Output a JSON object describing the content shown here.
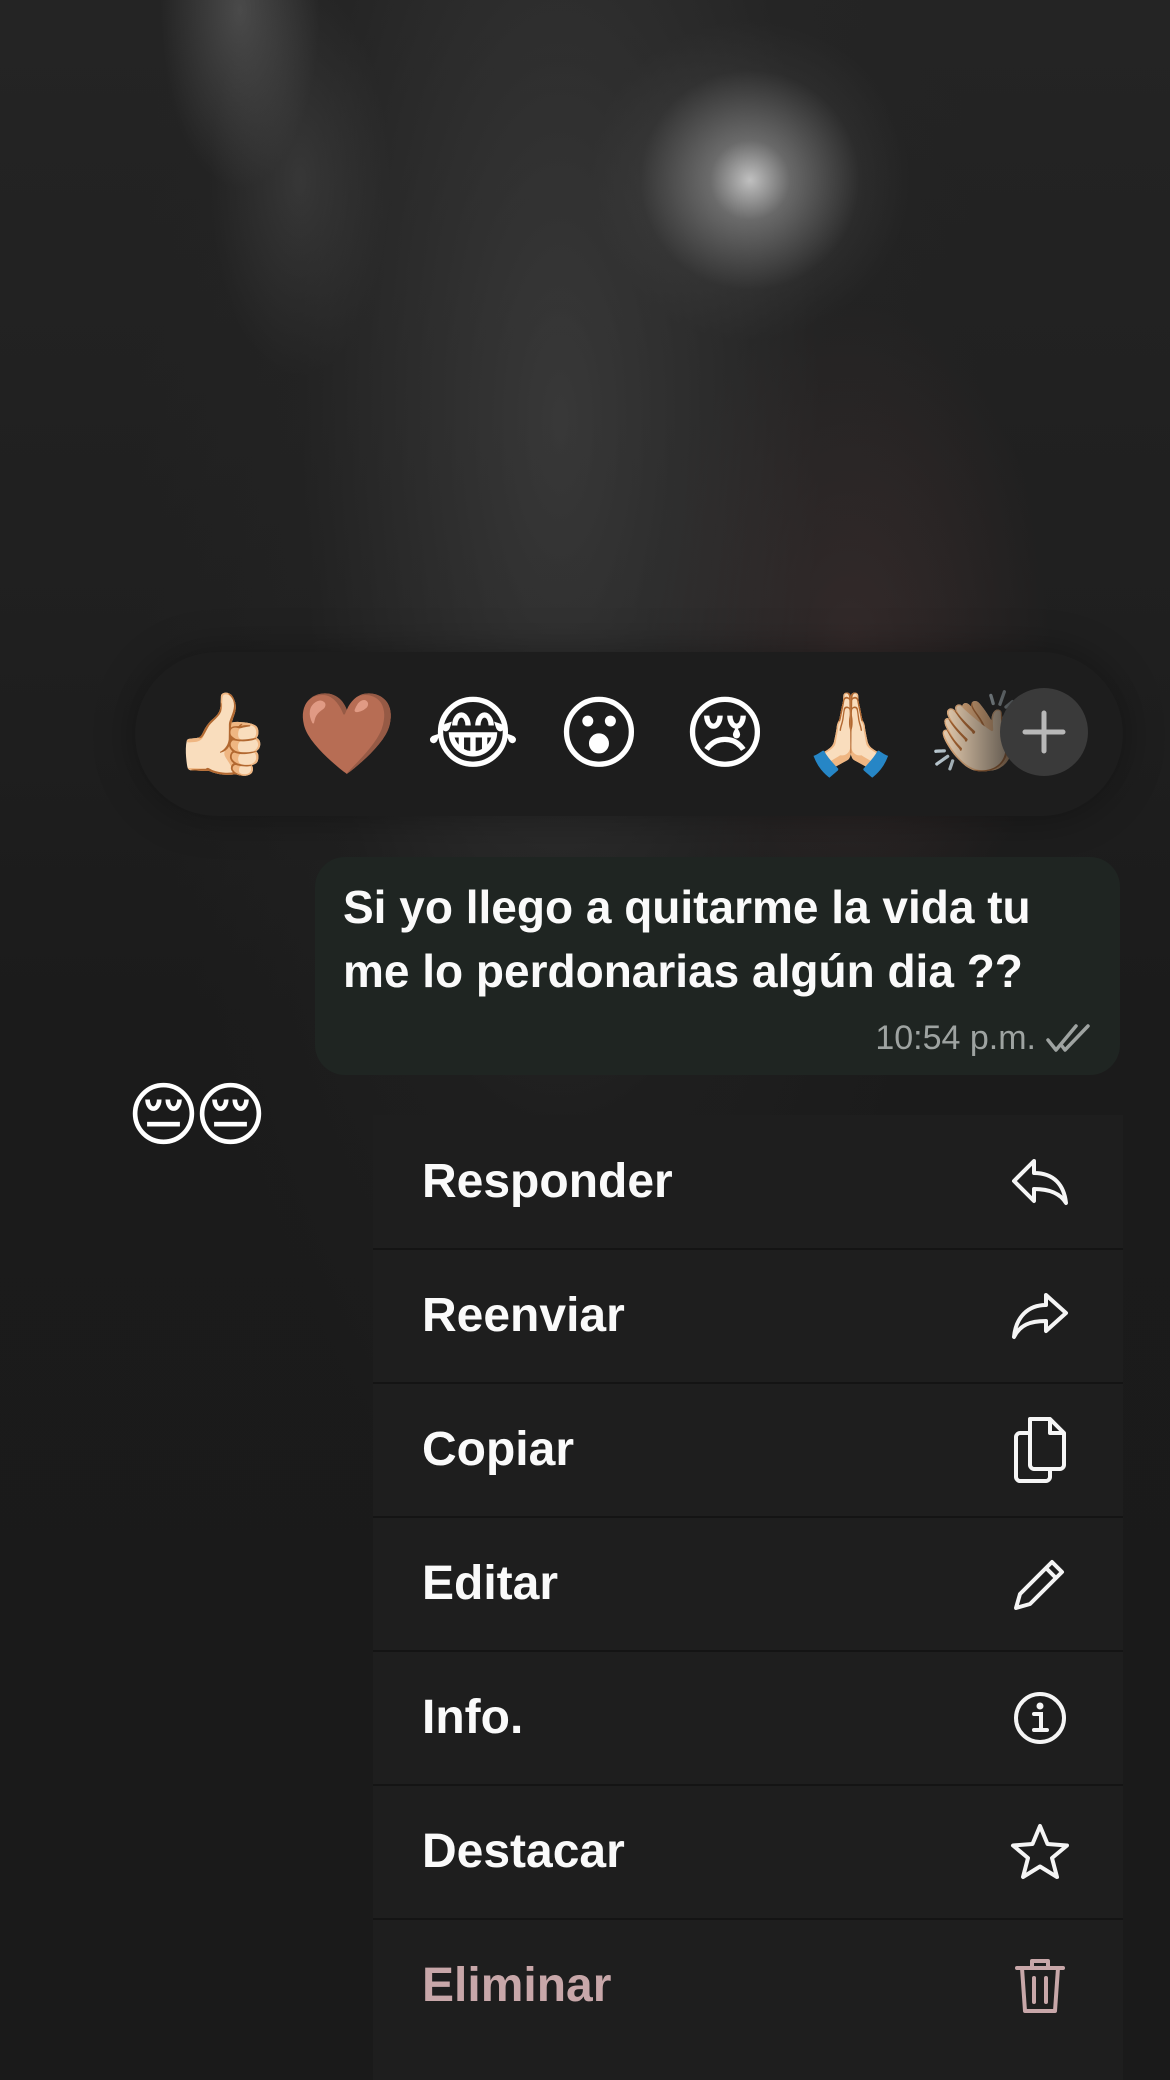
{
  "reaction_bar": {
    "reactions": [
      "👍🏻",
      "🤎",
      "😂",
      "😮",
      "😢",
      "🙏🏻",
      "👏🏻"
    ],
    "add_icon": "plus-icon"
  },
  "message": {
    "text": "Si yo llego a quitarme la vida tu me lo perdonarias algún dia ??",
    "time": "10:54 p.m.",
    "status_icon": "double-check-icon"
  },
  "side_reaction": "😔😔",
  "menu": {
    "items": [
      {
        "label": "Responder",
        "icon": "reply-icon"
      },
      {
        "label": "Reenviar",
        "icon": "forward-icon"
      },
      {
        "label": "Copiar",
        "icon": "copy-icon"
      },
      {
        "label": "Editar",
        "icon": "pencil-icon"
      },
      {
        "label": "Info.",
        "icon": "info-icon"
      },
      {
        "label": "Destacar",
        "icon": "star-icon"
      },
      {
        "label": "Eliminar",
        "icon": "trash-icon"
      }
    ]
  },
  "colors": {
    "destructive": "#c8a7a9",
    "bubble": "#1f2522",
    "menu_bg": "#1e1e1e",
    "checkmarks": "#9ea3a1"
  }
}
